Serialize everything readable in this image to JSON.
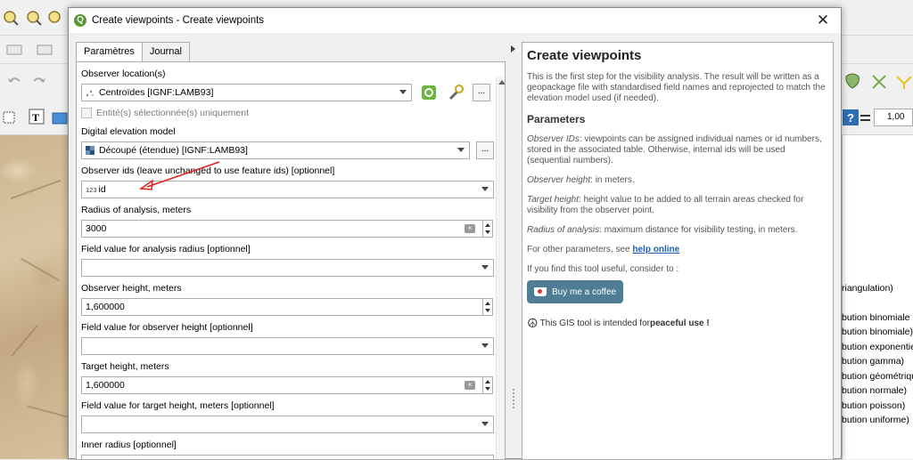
{
  "background": {
    "zoom_value": "1,00",
    "right_list": [
      "riangulation)",
      "bution binomiale n",
      "bution binomiale)",
      "bution exponentie",
      "bution gamma)",
      "bution géométriqu",
      "bution normale)",
      "bution poisson)",
      "bution uniforme)"
    ]
  },
  "dialog": {
    "title": "Create viewpoints - Create viewpoints",
    "close_glyph": "✕",
    "tabs": [
      {
        "label": "Paramètres",
        "active": true
      },
      {
        "label": "Journal",
        "active": false
      }
    ],
    "form": {
      "observer_location": {
        "label": "Observer location(s)",
        "value": "Centroïdes [IGNF:LAMB93]",
        "browse_label": "..."
      },
      "selected_only": {
        "label": "Entité(s) sélectionnée(s) uniquement",
        "checked": false
      },
      "dem": {
        "label": "Digital elevation model",
        "value": "Découpé (étendue) [IGNF:LAMB93]",
        "browse_label": "..."
      },
      "observer_ids": {
        "label": "Observer ids (leave unchanged to use feature ids) [optionnel]",
        "type_prefix": "123",
        "value": "id"
      },
      "radius": {
        "label": "Radius of analysis, meters",
        "value": "3000"
      },
      "radius_field": {
        "label": "Field value for analysis radius [optionnel]",
        "value": ""
      },
      "observer_height": {
        "label": "Observer height, meters",
        "value": "1,600000"
      },
      "observer_height_field": {
        "label": "Field value for observer height [optionnel]",
        "value": ""
      },
      "target_height": {
        "label": "Target height, meters",
        "value": "1,600000"
      },
      "target_height_field": {
        "label": "Field value for target height, meters [optionnel]",
        "value": ""
      },
      "inner_radius": {
        "label": "Inner radius [optionnel]",
        "value": ""
      }
    },
    "help": {
      "title": "Create viewpoints",
      "intro": "This is the first step for the visibility analysis. The result will be written as a geopackage file with standardised field names and reprojected to match the elevation model used (if needed).",
      "parameters_heading": "Parameters",
      "items": [
        {
          "term": "Observer IDs",
          "text": ": viewpoints can be assigned individual names or id numbers, stored in the associated table. Otherwise, internal ids will be used (sequential numbers)."
        },
        {
          "term": "Observer height",
          "text": ": in meters."
        },
        {
          "term": "Target height",
          "text": ": height value to be added to all terrain areas checked for visibility from the observer point."
        },
        {
          "term": "Radius of analysis",
          "text": ": maximum distance for visibility testing, in meters."
        }
      ],
      "other_params_prefix": "For other parameters, see ",
      "help_link": "help online",
      "useful_text": "If you find this tool useful, consider to :",
      "coffee_button": "Buy me a coffee",
      "peace_prefix": "This GIS tool is intended for ",
      "peace_bold": "peaceful use !"
    }
  },
  "colors": {
    "qgis_green": "#589632",
    "link": "#1a5fb4",
    "coffee": "#4f7d95",
    "annotation_arrow": "#e0201b"
  }
}
